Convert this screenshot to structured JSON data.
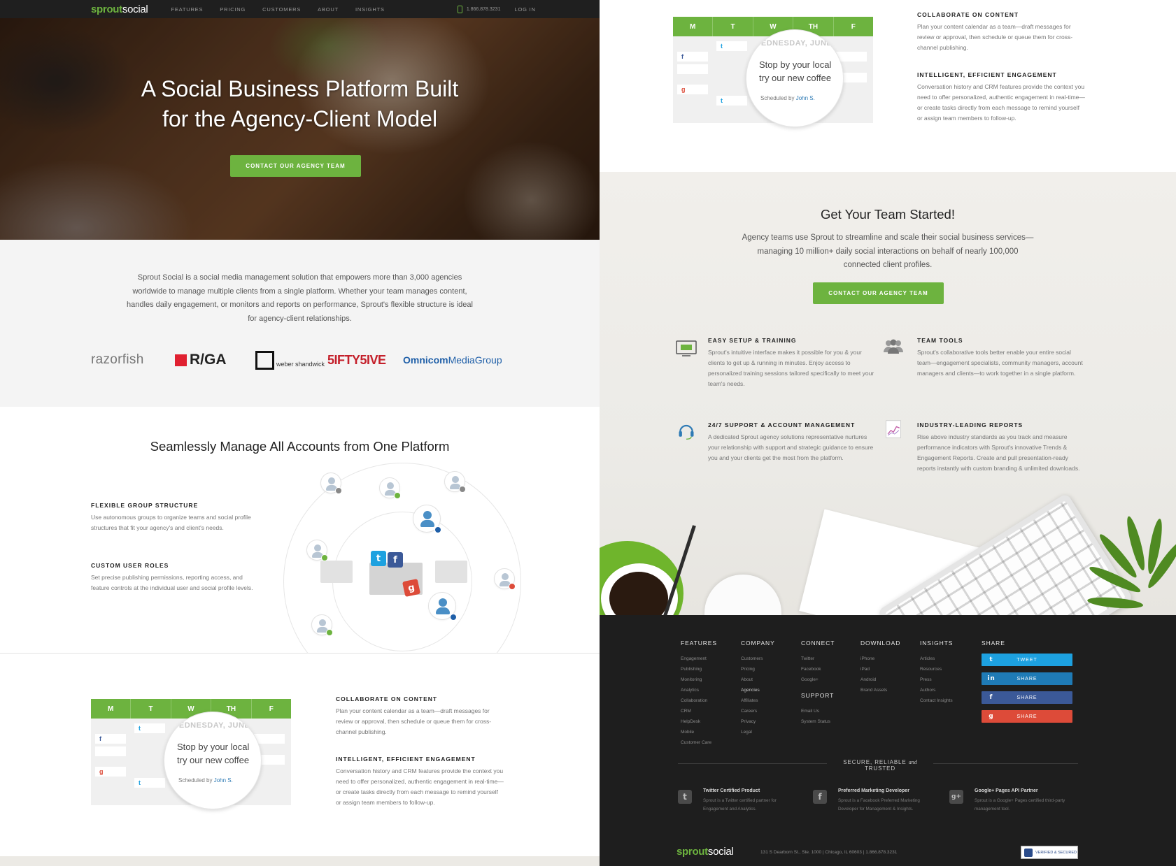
{
  "nav": {
    "logo_green": "sprout",
    "logo_white": "social",
    "links": [
      "FEATURES",
      "PRICING",
      "CUSTOMERS",
      "ABOUT",
      "INSIGHTS"
    ],
    "phone": "1.866.878.3231",
    "login": "LOG IN"
  },
  "hero": {
    "title_line1": "A Social Business Platform Built",
    "title_line2": "for the Agency-Client Model",
    "cta": "CONTACT OUR AGENCY TEAM"
  },
  "intro": {
    "text": "Sprout Social is a social media management solution that empowers more than 3,000 agencies worldwide to manage multiple clients from a single platform. Whether your team manages content, handles daily engagement, or monitors and reports on performance, Sprout's flexible structure is ideal for agency-client relationships.",
    "logos": {
      "razorfish": "razorfish",
      "rga": "R/GA",
      "weber": "weber shandwick",
      "fifty": "5IFTY5IVE",
      "omni_bold": "Omnicom",
      "omni_rest": "MediaGroup"
    }
  },
  "seamless": {
    "title": "Seamlessly Manage All Accounts from One Platform",
    "features": [
      {
        "title": "FLEXIBLE GROUP STRUCTURE",
        "text": "Use autonomous groups to organize teams and social profile structures that fit your agency's and client's needs."
      },
      {
        "title": "CUSTOM USER ROLES",
        "text": "Set precise publishing permissions, reporting access, and feature controls at the individual user and social profile levels."
      }
    ]
  },
  "calendar": {
    "days": [
      "M",
      "T",
      "W",
      "TH",
      "F"
    ],
    "bubble_day": "WEDNESDAY, JUNE",
    "bubble_msg_line1": "Stop by your local",
    "bubble_msg_line2": "try our new coffee",
    "scheduled_by": "Scheduled by",
    "scheduled_name": "John S."
  },
  "collab": {
    "features": [
      {
        "title": "COLLABORATE ON CONTENT",
        "text": "Plan your content calendar as a team—draft messages for review or approval, then schedule or queue them for cross-channel publishing."
      },
      {
        "title": "INTELLIGENT, EFFICIENT ENGAGEMENT",
        "text": "Conversation history and CRM features provide the context you need to offer personalized, authentic engagement in real-time—or create tasks directly from each message to remind yourself or assign team members to follow-up."
      }
    ]
  },
  "started": {
    "title": "Get Your Team Started!",
    "text": "Agency teams use Sprout to streamline and scale their social business services—managing 10 million+ daily social interactions on behalf of nearly 100,000 connected client profiles.",
    "cta": "CONTACT OUR AGENCY TEAM",
    "services": [
      {
        "title": "EASY SETUP & TRAINING",
        "text": "Sprout's intuitive interface makes it possible for you & your clients to get up & running in minutes. Enjoy access to personalized training sessions tailored specifically to meet your team's needs."
      },
      {
        "title": "TEAM TOOLS",
        "text": "Sprout's collaborative tools better enable your entire social team—engagement specialists, community managers, account managers and clients—to work together in a single platform."
      },
      {
        "title": "24/7 SUPPORT & ACCOUNT MANAGEMENT",
        "text": "A dedicated Sprout agency solutions representative nurtures your relationship with support and strategic guidance to ensure you and your clients get the most from the platform."
      },
      {
        "title": "INDUSTRY-LEADING REPORTS",
        "text": "Rise above industry standards as you track and measure performance indicators with Sprout's innovative Trends & Engagement Reports. Create and pull presentation-ready reports instantly with custom branding & unlimited downloads."
      }
    ]
  },
  "footer": {
    "features": {
      "title": "FEATURES",
      "items": [
        "Engagement",
        "Publishing",
        "Monitoring",
        "Analytics",
        "Collaboration",
        "CRM",
        "HelpDesk",
        "Mobile",
        "Customer Care"
      ]
    },
    "company": {
      "title": "COMPANY",
      "items": [
        "Customers",
        "Pricing",
        "About",
        "Agencies",
        "Affiliates",
        "Careers",
        "Privacy",
        "Legal"
      ]
    },
    "connect": {
      "title": "CONNECT",
      "items": [
        "Twitter",
        "Facebook",
        "Google+"
      ]
    },
    "support": {
      "title": "SUPPORT",
      "items": [
        "Email Us",
        "System Status"
      ]
    },
    "download": {
      "title": "DOWNLOAD",
      "items": [
        "iPhone",
        "iPad",
        "Android",
        "Brand Assets"
      ]
    },
    "insights": {
      "title": "INSIGHTS",
      "items": [
        "Articles",
        "Resources",
        "Press",
        "Authors",
        "Contact Insights"
      ]
    },
    "share": {
      "title": "SHARE",
      "buttons": [
        {
          "label": "TWEET",
          "color": "#1da1e0",
          "icon": "t"
        },
        {
          "label": "SHARE",
          "color": "#1f7bb6",
          "icon": "in"
        },
        {
          "label": "SHARE",
          "color": "#3b5998",
          "icon": "f"
        },
        {
          "label": "SHARE",
          "color": "#dd4b39",
          "icon": "g"
        }
      ]
    },
    "trusted_a": "SECURE, RELIABLE",
    "trusted_and": "and",
    "trusted_b": "TRUSTED",
    "badges": [
      {
        "title": "Twitter Certified Product",
        "text": "Sprout is a Twitter certified partner for Engagement and Analytics.",
        "icon": "t"
      },
      {
        "title": "Preferred Marketing Developer",
        "text": "Sprout is a Facebook Preferred Marketing Developer for Management & Insights.",
        "icon": "f"
      },
      {
        "title": "Google+ Pages API Partner",
        "text": "Sprout is a Google+ Pages certified third-party management tool.",
        "icon": "g+"
      }
    ],
    "address": "131 S Dearborn St., Ste. 1000  |  Chicago, IL 60603  |  1.866.878.3231",
    "verified": "VERIFIED & SECURED"
  },
  "colors": {
    "brand_green": "#6db33f",
    "footer_bg": "#1e1e1e",
    "link_blue": "#2f7bb5"
  }
}
